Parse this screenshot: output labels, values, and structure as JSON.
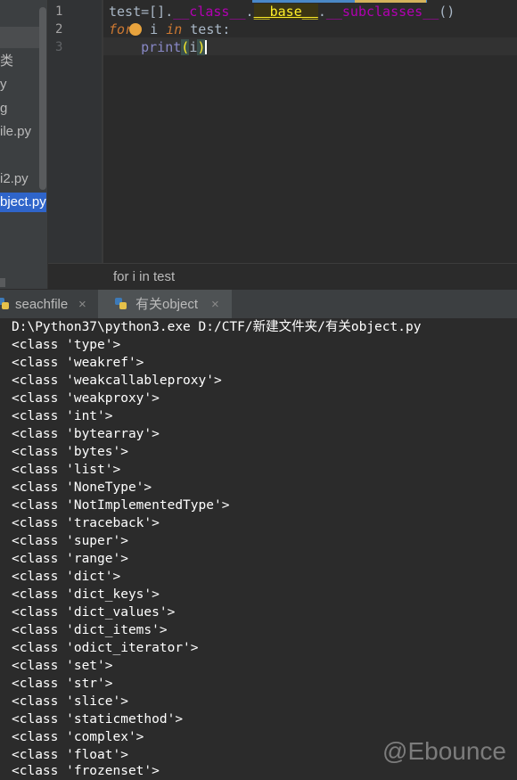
{
  "sidebar": {
    "items": [
      {
        "label": "类"
      },
      {
        "label": "y"
      },
      {
        "label": "g"
      },
      {
        "label": "ile.py"
      },
      {
        "label": "i2.py"
      },
      {
        "label": "bject.py"
      }
    ]
  },
  "editor": {
    "line_numbers": [
      "1",
      "2",
      "3"
    ],
    "code": {
      "l1_a": "test=[].",
      "l1_class": "__class__",
      "l1_dot1": ".",
      "l1_base": "__base__",
      "l1_dot2": ".",
      "l1_sub": "__subclasses__",
      "l1_end": "()",
      "l2_for": "for",
      "l2_mid": " i ",
      "l2_in": "in",
      "l2_end": " test:",
      "l3_indent": "    ",
      "l3_print": "print",
      "l3_lp": "(",
      "l3_i": "i",
      "l3_rp": ")"
    },
    "breadcrumb": "for i in test"
  },
  "run": {
    "tabs": [
      {
        "label": "seachfile",
        "close": "×"
      },
      {
        "label": "有关object",
        "close": "×"
      }
    ]
  },
  "console": {
    "lines": [
      "D:\\Python37\\python3.exe D:/CTF/新建文件夹/有关object.py",
      "<class 'type'>",
      "<class 'weakref'>",
      "<class 'weakcallableproxy'>",
      "<class 'weakproxy'>",
      "<class 'int'>",
      "<class 'bytearray'>",
      "<class 'bytes'>",
      "<class 'list'>",
      "<class 'NoneType'>",
      "<class 'NotImplementedType'>",
      "<class 'traceback'>",
      "<class 'super'>",
      "<class 'range'>",
      "<class 'dict'>",
      "<class 'dict_keys'>",
      "<class 'dict_values'>",
      "<class 'dict_items'>",
      "<class 'odict_iterator'>",
      "<class 'set'>",
      "<class 'str'>",
      "<class 'slice'>",
      "<class 'staticmethod'>",
      "<class 'complex'>",
      "<class 'float'>",
      "<class 'frozenset'>"
    ]
  },
  "watermark": "@Ebounce",
  "icons": {
    "run_tab_icon": "python-file-icon",
    "gutter_hint": "intention-bulb-icon"
  },
  "colors": {
    "background": "#2b2b2b",
    "sidebar": "#3c3f41",
    "keyword": "#cc7832",
    "dunder": "#b200b2",
    "selected": "#2f65ca"
  }
}
